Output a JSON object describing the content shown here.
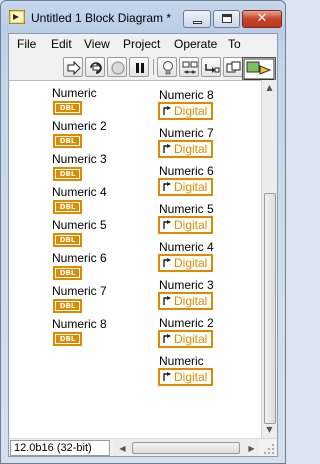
{
  "window": {
    "title": "Untitled 1 Block Diagram *",
    "close_glyph": "✕"
  },
  "menu": [
    "File",
    "Edit",
    "View",
    "Project",
    "Operate",
    "To"
  ],
  "toolbar": {
    "icons": [
      "run-arrow-icon",
      "run-continuously-icon",
      "abort-icon",
      "pause-icon",
      "highlight-execution-icon",
      "retain-wire-values-icon",
      "step-into-icon",
      "step-over-icon"
    ],
    "connector_pane_number": "1"
  },
  "diagram": {
    "controls": [
      {
        "label": "Numeric",
        "type": "DBL"
      },
      {
        "label": "Numeric 2",
        "type": "DBL"
      },
      {
        "label": "Numeric 3",
        "type": "DBL"
      },
      {
        "label": "Numeric 4",
        "type": "DBL"
      },
      {
        "label": "Numeric 5",
        "type": "DBL"
      },
      {
        "label": "Numeric 6",
        "type": "DBL"
      },
      {
        "label": "Numeric 7",
        "type": "DBL"
      },
      {
        "label": "Numeric 8",
        "type": "DBL"
      }
    ],
    "indicators": [
      {
        "label": "Numeric 8",
        "type": "Digital"
      },
      {
        "label": "Numeric 7",
        "type": "Digital"
      },
      {
        "label": "Numeric 6",
        "type": "Digital"
      },
      {
        "label": "Numeric 5",
        "type": "Digital"
      },
      {
        "label": "Numeric 4",
        "type": "Digital"
      },
      {
        "label": "Numeric 3",
        "type": "Digital"
      },
      {
        "label": "Numeric 2",
        "type": "Digital"
      },
      {
        "label": "Numeric",
        "type": "Digital"
      }
    ],
    "terminal_color": "#e08a00"
  },
  "statusbar": {
    "version": "12.0b16 (32-bit)"
  }
}
